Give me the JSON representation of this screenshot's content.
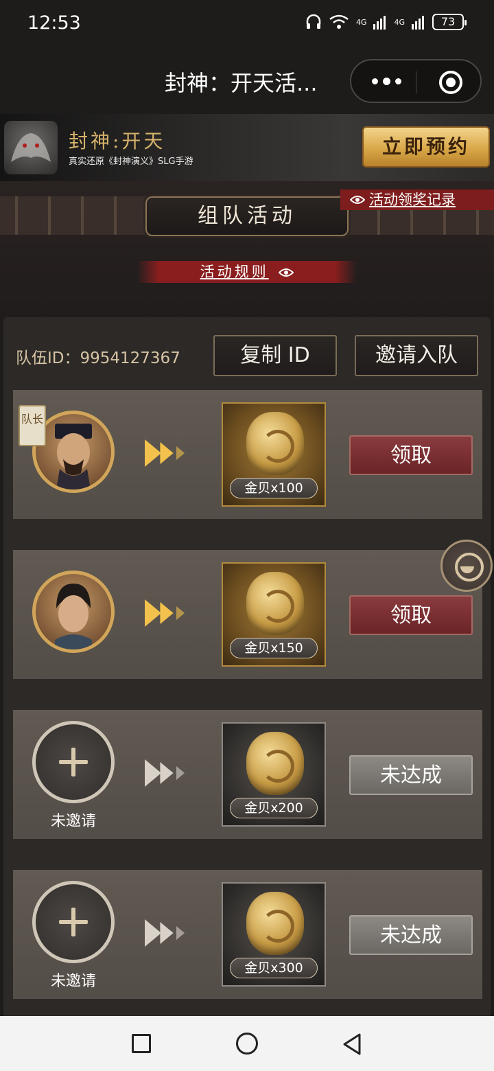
{
  "status_bar": {
    "time": "12:53",
    "network_1": "4G",
    "network_2": "4G",
    "battery": "73"
  },
  "title_bar": {
    "title": "封神：开天活..."
  },
  "banner": {
    "game_name": "封神:开天",
    "slogan": "真实还原《封神演义》SLG手游",
    "reserve_label": "立即预约"
  },
  "activity": {
    "section_title": "组队活动",
    "record_link": "活动领奖记录",
    "rules_link": "活动规则"
  },
  "team": {
    "id_label": "队伍ID：9954127367",
    "copy_label": "复制 ID",
    "invite_label": "邀请入队",
    "captain_badge": "队长"
  },
  "rewards": [
    {
      "reward": "金贝x100",
      "action": "领取",
      "state": "claimable",
      "member": "captain"
    },
    {
      "reward": "金贝x150",
      "action": "领取",
      "state": "claimable",
      "member": "member"
    },
    {
      "reward": "金贝x200",
      "action": "未达成",
      "state": "locked",
      "member_label": "未邀请"
    },
    {
      "reward": "金贝x300",
      "action": "未达成",
      "state": "locked",
      "member_label": "未邀请"
    }
  ],
  "colors": {
    "gold": "#d6b36a",
    "claim_button": "#7a2e31",
    "locked_button": "#7c7873",
    "record_red": "#7e1d1d"
  }
}
